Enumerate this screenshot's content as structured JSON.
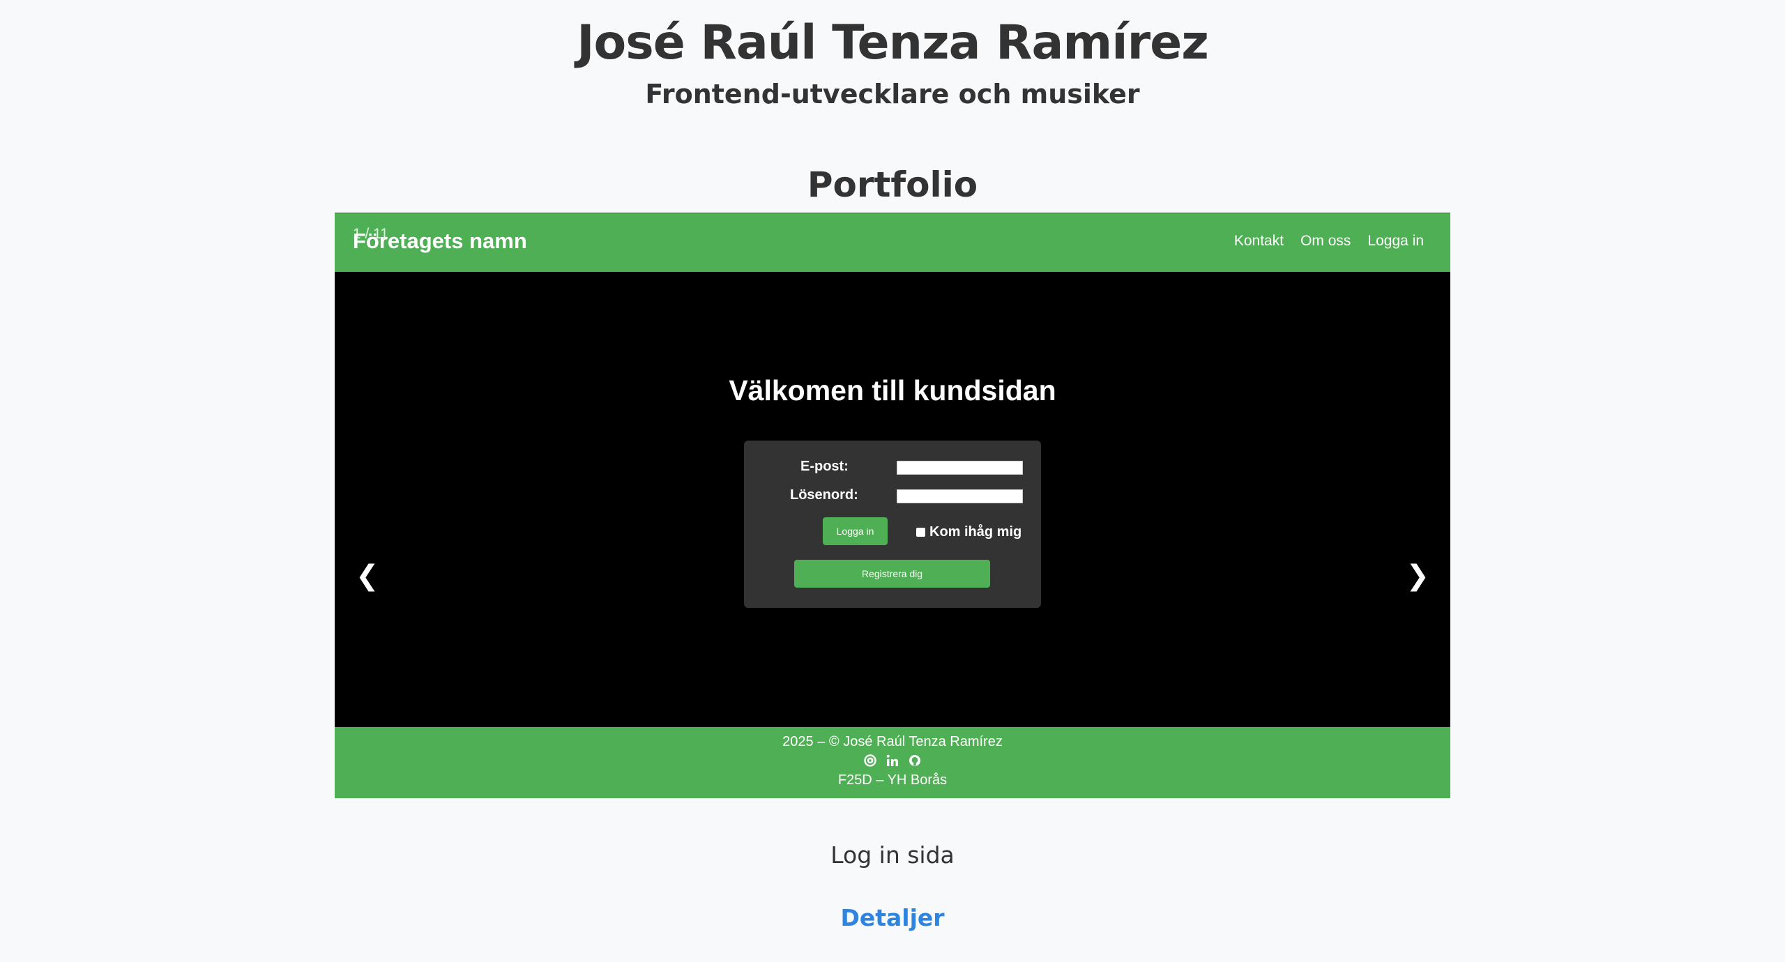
{
  "hero": {
    "name": "José Raúl Tenza Ramírez",
    "subtitle": "Frontend-utvecklare och musiker"
  },
  "portfolio": {
    "title": "Portfolio",
    "counter": "1 / 11",
    "prev_arrow": "❮",
    "next_arrow": "❯",
    "caption": "Log in sida",
    "details_label": "Detaljer",
    "colors": {
      "accent": "#4faf54",
      "link": "#2f84e0",
      "box": "#333333"
    }
  },
  "demo": {
    "brand": "Företagets namn",
    "nav": [
      "Kontakt",
      "Om oss",
      "Logga in"
    ],
    "heading": "Välkomen till kundsidan",
    "email_label": "E-post:",
    "password_label": "Lösenord:",
    "login_button": "Logga in",
    "remember_label": "Kom ihåg mig",
    "register_button": "Registrera dig",
    "footer": {
      "copyright": "2025 – © José Raúl Tenza Ramírez",
      "icons": [
        "at-icon",
        "linkedin-icon",
        "github-icon"
      ],
      "school": "F25D – YH Borås"
    }
  }
}
